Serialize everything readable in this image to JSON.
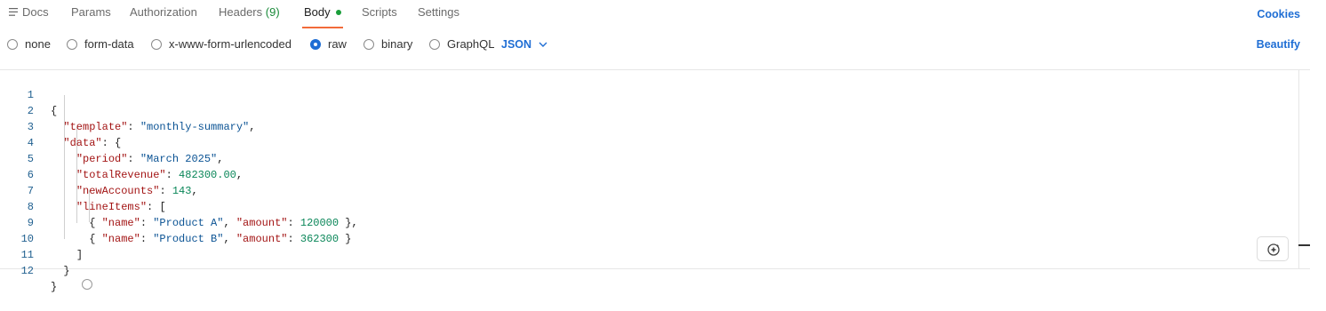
{
  "tabs": {
    "docs": "Docs",
    "params": "Params",
    "authorization": "Authorization",
    "headers": "Headers",
    "headers_count": "(9)",
    "body": "Body",
    "scripts": "Scripts",
    "settings": "Settings",
    "active": "Body"
  },
  "cookies_label": "Cookies",
  "body_types": {
    "none": "none",
    "form_data": "form-data",
    "urlencoded": "x-www-form-urlencoded",
    "raw": "raw",
    "binary": "binary",
    "graphql": "GraphQL",
    "selected": "raw"
  },
  "language": "JSON",
  "beautify_label": "Beautify",
  "editor": {
    "line_numbers": [
      "1",
      "2",
      "3",
      "4",
      "5",
      "6",
      "7",
      "8",
      "9",
      "10",
      "11",
      "12"
    ],
    "code": {
      "l1_open": "{",
      "l2_key": "\"template\"",
      "l2_val": "\"monthly-summary\"",
      "l3_key": "\"data\"",
      "l3_open": "{",
      "l4_key": "\"period\"",
      "l4_val": "\"March 2025\"",
      "l5_key": "\"totalRevenue\"",
      "l5_val": "482300.00",
      "l6_key": "\"newAccounts\"",
      "l6_val": "143",
      "l7_key": "\"lineItems\"",
      "l7_open": "[",
      "l8_name_key": "\"name\"",
      "l8_name_val": "\"Product A\"",
      "l8_amount_key": "\"amount\"",
      "l8_amount_val": "120000",
      "l9_name_key": "\"name\"",
      "l9_name_val": "\"Product B\"",
      "l9_amount_key": "\"amount\"",
      "l9_amount_val": "362300",
      "l10_close": "]",
      "l11_close": "}",
      "l12_close": "}"
    }
  },
  "colors": {
    "accent_blue": "#1f6ed4",
    "tab_underline": "#f26b3a",
    "status_green": "#1a9e3a",
    "json_key": "#a31515",
    "json_string": "#0b5394",
    "json_number": "#098658"
  },
  "icons": {
    "docs": "docs-lines-icon",
    "dropdown": "chevron-down-icon",
    "fab": "assistant-sparkle-icon"
  }
}
